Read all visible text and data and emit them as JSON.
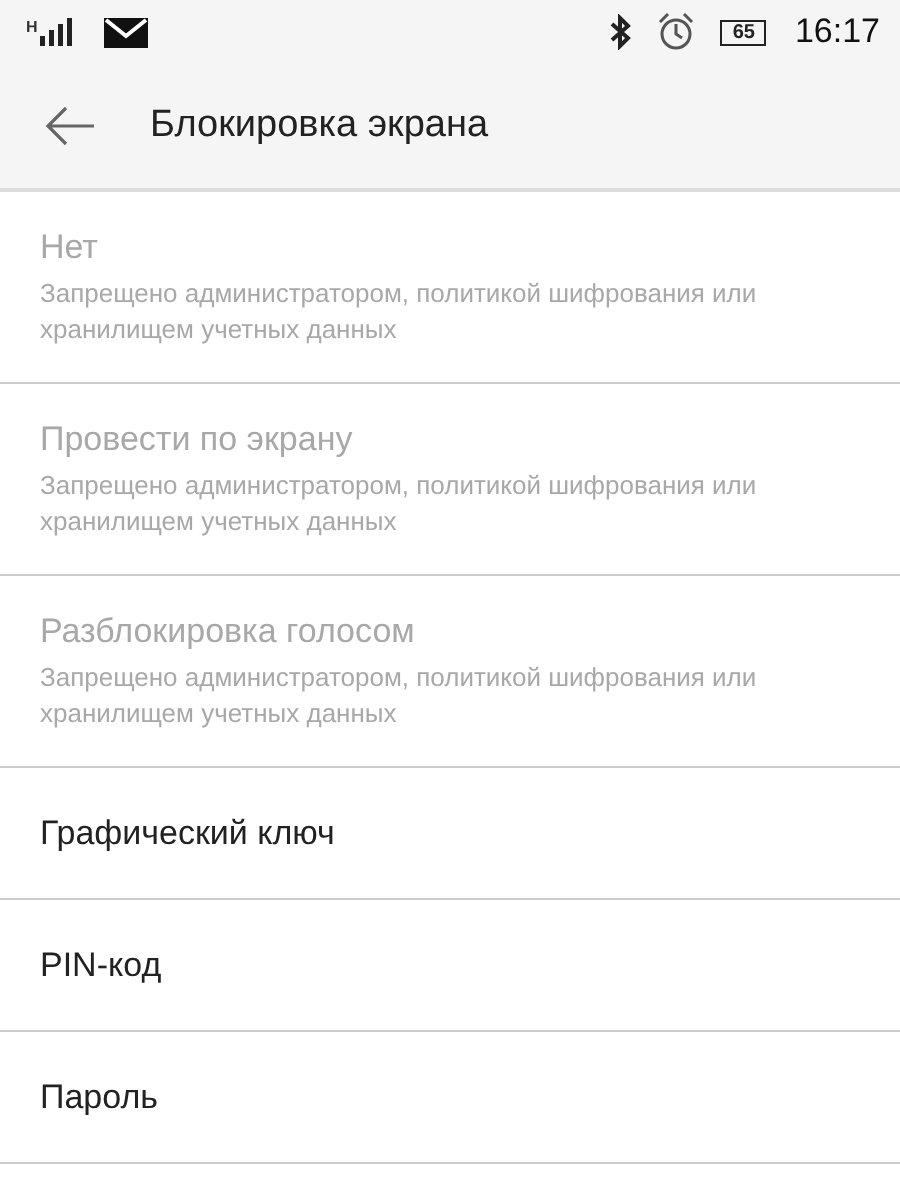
{
  "status_bar": {
    "network": "H",
    "battery": "65",
    "time": "16:17"
  },
  "header": {
    "title": "Блокировка экрана"
  },
  "options": [
    {
      "title": "Нет",
      "subtitle": "Запрещено администратором, политикой шифрования или хранилищем учетных данных",
      "disabled": true
    },
    {
      "title": "Провести по экрану",
      "subtitle": "Запрещено администратором, политикой шифрования или хранилищем учетных данных",
      "disabled": true
    },
    {
      "title": "Разблокировка голосом",
      "subtitle": "Запрещено администратором, политикой шифрования или хранилищем учетных данных",
      "disabled": true
    },
    {
      "title": "Графический ключ",
      "disabled": false
    },
    {
      "title": "PIN-код",
      "disabled": false
    },
    {
      "title": "Пароль",
      "disabled": false
    }
  ]
}
